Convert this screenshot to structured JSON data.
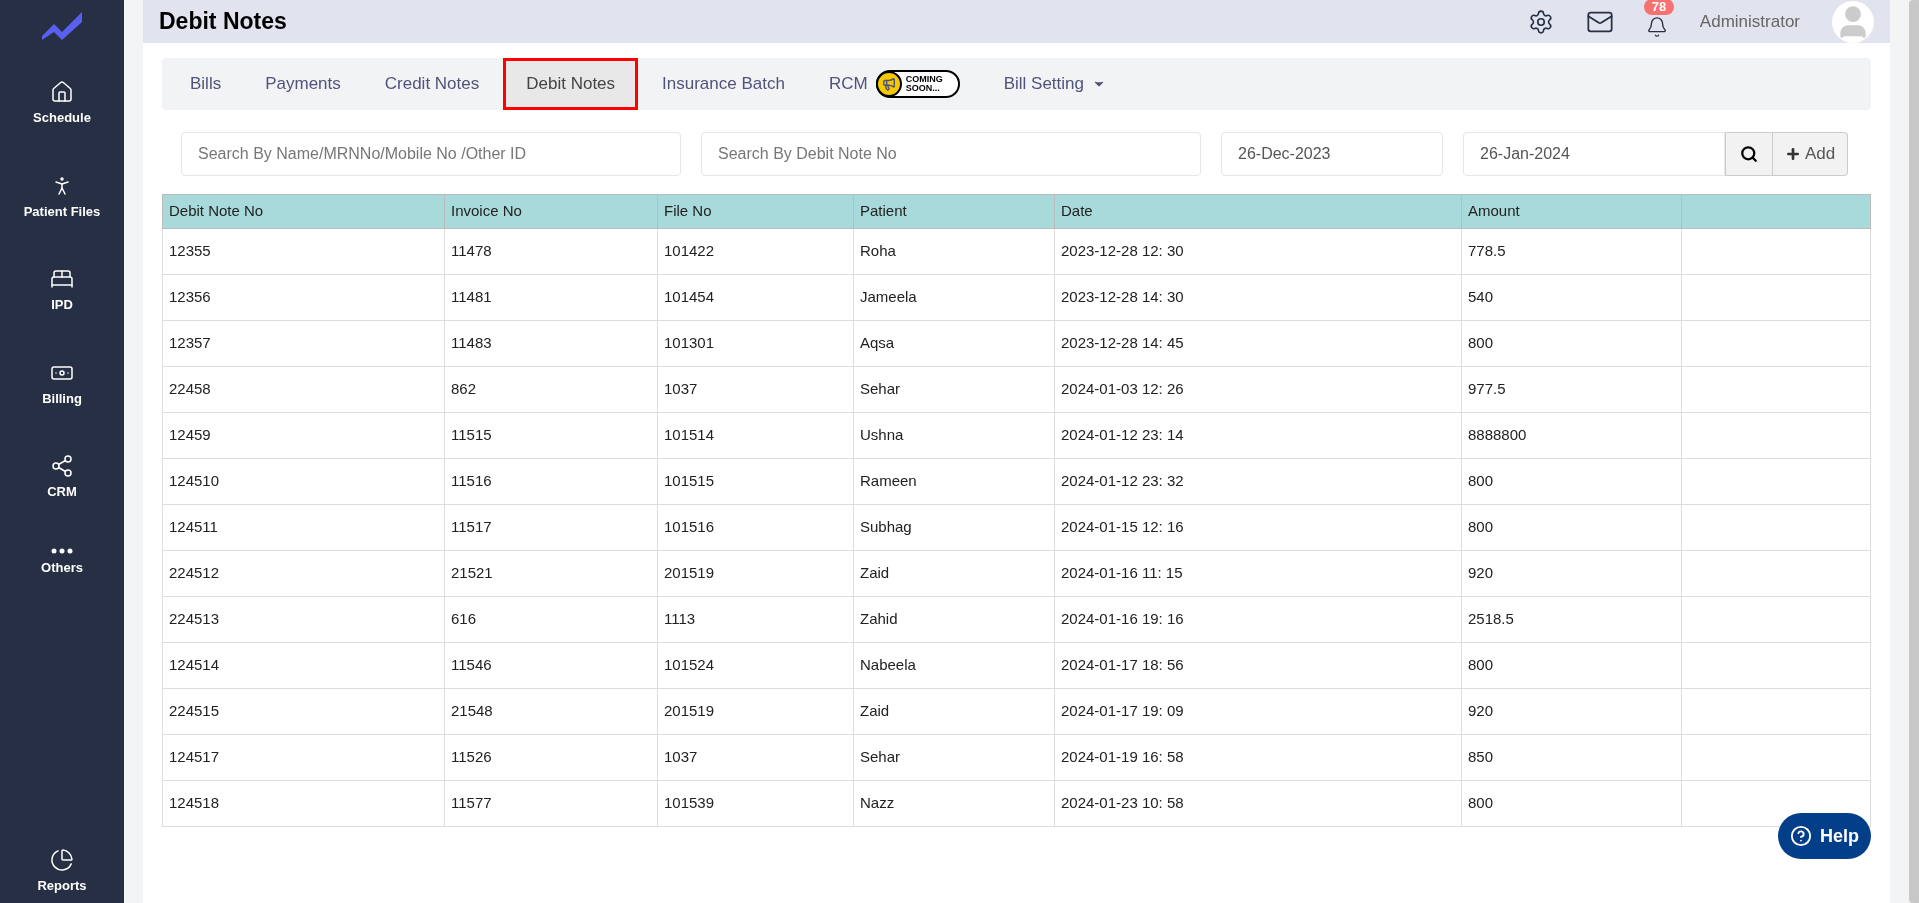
{
  "sidebar": {
    "items": [
      {
        "label": "Schedule"
      },
      {
        "label": "Patient Files"
      },
      {
        "label": "IPD"
      },
      {
        "label": "Billing"
      },
      {
        "label": "CRM"
      },
      {
        "label": "Others"
      }
    ],
    "bottom": {
      "label": "Reports"
    }
  },
  "header": {
    "title": "Debit Notes",
    "notification_count": "78",
    "user": "Administrator"
  },
  "tabs": [
    {
      "label": "Bills",
      "selected": false,
      "kind": "link"
    },
    {
      "label": "Payments",
      "selected": false,
      "kind": "link"
    },
    {
      "label": "Credit Notes",
      "selected": false,
      "kind": "link"
    },
    {
      "label": "Debit Notes",
      "selected": true,
      "kind": "link"
    },
    {
      "label": "Insurance Batch",
      "selected": false,
      "kind": "link"
    },
    {
      "label": "RCM",
      "selected": false,
      "kind": "link",
      "badge": "COMING SOON..."
    },
    {
      "label": "Bill Setting",
      "selected": false,
      "kind": "dropdown"
    }
  ],
  "filters": {
    "search_name": {
      "placeholder": "Search By Name/MRNNo/Mobile No /Other ID"
    },
    "search_debit_note": {
      "placeholder": "Search By Debit Note No"
    },
    "date_from": {
      "value": "26-Dec-2023"
    },
    "date_to": {
      "value": "26-Jan-2024"
    },
    "add_button": "Add"
  },
  "table": {
    "columns": [
      "Debit Note No",
      "Invoice No",
      "File No",
      "Patient",
      "Date",
      "Amount"
    ],
    "rows": [
      [
        "12355",
        "11478",
        "101422",
        "Roha",
        "2023-12-28 12: 30",
        "778.5"
      ],
      [
        "12356",
        "11481",
        "101454",
        "Jameela",
        "2023-12-28 14: 30",
        "540"
      ],
      [
        "12357",
        "11483",
        "101301",
        "Aqsa",
        "2023-12-28 14: 45",
        "800"
      ],
      [
        "22458",
        "862",
        "1037",
        "Sehar",
        "2024-01-03 12: 26",
        "977.5"
      ],
      [
        "12459",
        "11515",
        "101514",
        "Ushna",
        "2024-01-12 23: 14",
        "8888800"
      ],
      [
        "124510",
        "11516",
        "101515",
        "Rameen",
        "2024-01-12 23: 32",
        "800"
      ],
      [
        "124511",
        "11517",
        "101516",
        "Subhag",
        "2024-01-15 12: 16",
        "800"
      ],
      [
        "224512",
        "21521",
        "201519",
        "Zaid",
        "2024-01-16 11: 15",
        "920"
      ],
      [
        "224513",
        "616",
        "1113",
        "Zahid",
        "2024-01-16 19: 16",
        "2518.5"
      ],
      [
        "124514",
        "11546",
        "101524",
        "Nabeela",
        "2024-01-17 18: 56",
        "800"
      ],
      [
        "224515",
        "21548",
        "201519",
        "Zaid",
        "2024-01-17 19: 09",
        "920"
      ],
      [
        "124517",
        "11526",
        "1037",
        "Sehar",
        "2024-01-19 16: 58",
        "850"
      ],
      [
        "124518",
        "11577",
        "101539",
        "Nazz",
        "2024-01-23 10: 58",
        "800"
      ]
    ]
  },
  "help_button": "Help"
}
